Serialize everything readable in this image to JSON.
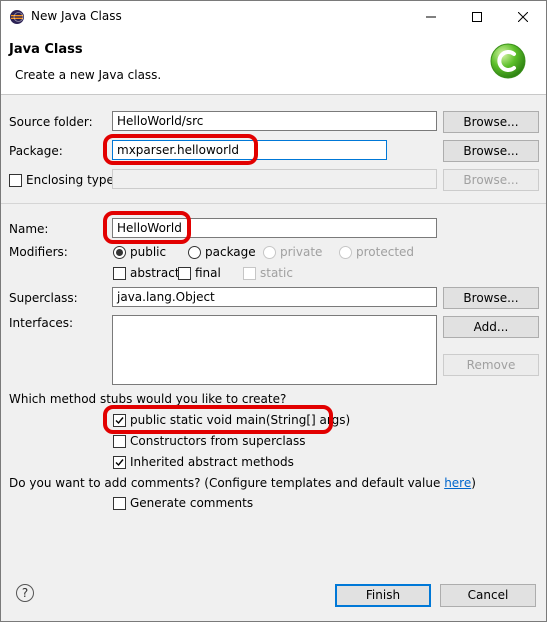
{
  "window": {
    "title": "New Java Class"
  },
  "header": {
    "title": "Java Class",
    "description": "Create a new Java class."
  },
  "icons": {
    "app": "eclipse-icon",
    "logo": "java-class-logo-icon",
    "help": "help-icon"
  },
  "source_folder": {
    "label": "Source folder:",
    "value": "HelloWorld/src",
    "button": "Browse..."
  },
  "package": {
    "label": "Package:",
    "value": "mxparser.helloworld",
    "button": "Browse..."
  },
  "enclosing_type": {
    "label": "Enclosing type:",
    "value": "",
    "button": "Browse...",
    "checked": false
  },
  "name": {
    "label": "Name:",
    "value": "HelloWorld"
  },
  "modifiers": {
    "label": "Modifiers:",
    "access": [
      {
        "label": "public",
        "selected": true,
        "enabled": true
      },
      {
        "label": "package",
        "selected": false,
        "enabled": true
      },
      {
        "label": "private",
        "selected": false,
        "enabled": false
      },
      {
        "label": "protected",
        "selected": false,
        "enabled": false
      }
    ],
    "flags": [
      {
        "label": "abstract",
        "checked": false,
        "enabled": true
      },
      {
        "label": "final",
        "checked": false,
        "enabled": true
      },
      {
        "label": "static",
        "checked": false,
        "enabled": false
      }
    ]
  },
  "superclass": {
    "label": "Superclass:",
    "value": "java.lang.Object",
    "button": "Browse..."
  },
  "interfaces": {
    "label": "Interfaces:",
    "add_button": "Add...",
    "remove_button": "Remove"
  },
  "stubs": {
    "question": "Which method stubs would you like to create?",
    "options": [
      {
        "label": "public static void main(String[] args)",
        "checked": true
      },
      {
        "label": "Constructors from superclass",
        "checked": false
      },
      {
        "label": "Inherited abstract methods",
        "checked": true
      }
    ]
  },
  "comments": {
    "question_prefix": "Do you want to add comments? (Configure templates and default value ",
    "link": "here",
    "question_suffix": ")",
    "option": {
      "label": "Generate comments",
      "checked": false
    }
  },
  "footer": {
    "finish": "Finish",
    "cancel": "Cancel",
    "help": "?"
  },
  "colors": {
    "highlight": "#e20000",
    "accent": "#0078d7",
    "link": "#0066cc"
  }
}
